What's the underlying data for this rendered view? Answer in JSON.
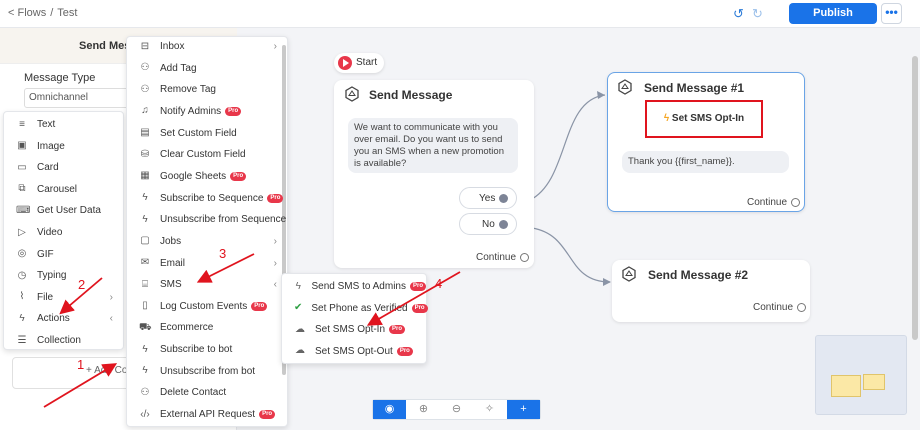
{
  "topbar": {
    "crumb_back": "< Flows",
    "crumb_sep": "/",
    "crumb_current": "Test",
    "publish_label": "Publish",
    "more_label": "•••"
  },
  "left_panel": {
    "title": "Send Messa",
    "message_type_label": "Message Type",
    "message_type_value": "Omnichannel",
    "add_label": "+ Add Co"
  },
  "content_menu": {
    "items": [
      {
        "icon": "text-icon",
        "glyph": "≡",
        "label": "Text"
      },
      {
        "icon": "image-icon",
        "glyph": "▣",
        "label": "Image"
      },
      {
        "icon": "card-icon",
        "glyph": "▭",
        "label": "Card"
      },
      {
        "icon": "carousel-icon",
        "glyph": "⧉",
        "label": "Carousel"
      },
      {
        "icon": "keyboard-icon",
        "glyph": "⌨",
        "label": "Get User Data"
      },
      {
        "icon": "video-icon",
        "glyph": "▷",
        "label": "Video"
      },
      {
        "icon": "gif-icon",
        "glyph": "◎",
        "label": "GIF"
      },
      {
        "icon": "clock-icon",
        "glyph": "◷",
        "label": "Typing"
      },
      {
        "icon": "clip-icon",
        "glyph": "⌇",
        "label": "File"
      },
      {
        "icon": "bolt-icon",
        "glyph": "ϟ",
        "label": "Actions"
      },
      {
        "icon": "list-icon",
        "glyph": "☰",
        "label": "Collection"
      }
    ]
  },
  "actions_menu": {
    "items": [
      {
        "icon": "inbox-icon",
        "glyph": "⊟",
        "label": "Inbox",
        "pro": false,
        "chev": true
      },
      {
        "icon": "tag-icon",
        "glyph": "⚇",
        "label": "Add Tag",
        "pro": false
      },
      {
        "icon": "tag-remove-icon",
        "glyph": "⚇",
        "label": "Remove Tag",
        "pro": false
      },
      {
        "icon": "bell-icon",
        "glyph": "♫",
        "label": "Notify Admins",
        "pro": true
      },
      {
        "icon": "field-icon",
        "glyph": "▤",
        "label": "Set Custom Field",
        "pro": false
      },
      {
        "icon": "database-icon",
        "glyph": "⛁",
        "label": "Clear Custom Field",
        "pro": false
      },
      {
        "icon": "sheet-icon",
        "glyph": "▦",
        "label": "Google Sheets",
        "pro": true
      },
      {
        "icon": "subscribe-icon",
        "glyph": "ϟ",
        "label": "Subscribe to Sequence",
        "pro": true
      },
      {
        "icon": "unsubscribe-icon",
        "glyph": "ϟ",
        "label": "Unsubscribe from Sequence",
        "pro": false
      },
      {
        "icon": "jobs-icon",
        "glyph": "▢",
        "label": "Jobs",
        "pro": false,
        "chev": true
      },
      {
        "icon": "email-icon",
        "glyph": "✉",
        "label": "Email",
        "pro": false,
        "chev": true
      },
      {
        "icon": "sms-icon",
        "glyph": "⌸",
        "label": "SMS",
        "pro": false,
        "chev": true
      },
      {
        "icon": "log-icon",
        "glyph": "▯",
        "label": "Log Custom Events",
        "pro": true
      },
      {
        "icon": "cart-icon",
        "glyph": "⛟",
        "label": "Ecommerce",
        "pro": false
      },
      {
        "icon": "bot-sub-icon",
        "glyph": "ϟ",
        "label": "Subscribe to bot",
        "pro": false
      },
      {
        "icon": "bot-unsub-icon",
        "glyph": "ϟ",
        "label": "Unsubscribe from bot",
        "pro": false
      },
      {
        "icon": "contact-delete-icon",
        "glyph": "⚇",
        "label": "Delete Contact",
        "pro": false
      },
      {
        "icon": "code-icon",
        "glyph": "‹/›",
        "label": "External API Request",
        "pro": true
      }
    ]
  },
  "sms_menu": {
    "items": [
      {
        "icon": "bolt-icon",
        "glyph": "ϟ",
        "label": "Send SMS to Admins",
        "pro": true,
        "color": "#666"
      },
      {
        "icon": "check-circle-icon",
        "glyph": "✔",
        "label": "Set Phone as Verified",
        "pro": true,
        "color": "#2ea043"
      },
      {
        "icon": "cloud-icon",
        "glyph": "☁",
        "label": "Set SMS Opt-In",
        "pro": true,
        "color": "#666"
      },
      {
        "icon": "cloud-off-icon",
        "glyph": "☁",
        "label": "Set SMS Opt-Out",
        "pro": true,
        "color": "#666"
      }
    ]
  },
  "pro_label": "Pro",
  "start_label": "Start",
  "node_main": {
    "title": "Send Message",
    "body": "We want to communicate with you over email. Do you want us to send you an SMS when a new promotion is available?",
    "yes_label": "Yes",
    "no_label": "No",
    "continue_label": "Continue"
  },
  "node_1": {
    "title": "Send Message #1",
    "action_label": "Set SMS Opt-In",
    "message": "Thank you {{first_name}}.",
    "continue_label": "Continue"
  },
  "node_2": {
    "title": "Send Message #2",
    "continue_label": "Continue"
  },
  "annotations": {
    "n1": "1",
    "n2": "2",
    "n3": "3",
    "n4": "4"
  },
  "zoom_controls": [
    {
      "icon": "eye-icon",
      "glyph": "◉"
    },
    {
      "icon": "zoom-in-icon",
      "glyph": "⊕"
    },
    {
      "icon": "zoom-out-icon",
      "glyph": "⊖"
    },
    {
      "icon": "sparkle-icon",
      "glyph": "✧"
    },
    {
      "icon": "plus-icon",
      "glyph": "+"
    }
  ],
  "colors": {
    "accent": "#1a73e8",
    "pro_badge": "#e8374a",
    "annotation": "#e0141e"
  }
}
